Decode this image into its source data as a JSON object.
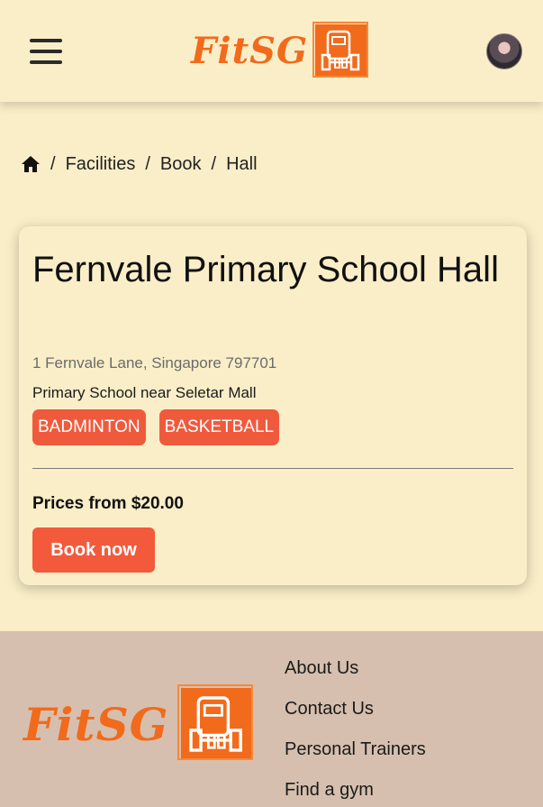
{
  "header": {
    "logo_text": "FitSG"
  },
  "breadcrumb": {
    "items": [
      "Facilities",
      "Book",
      "Hall"
    ]
  },
  "facility": {
    "title": "Fernvale Primary School Hall",
    "address": "1 Fernvale Lane, Singapore 797701",
    "description": "Primary School near Seletar Mall",
    "tags": [
      "BADMINTON",
      "BASKETBALL"
    ],
    "price_text": "Prices from $20.00",
    "book_label": "Book now"
  },
  "footer": {
    "logo_text": "FitSG",
    "links": [
      "About Us",
      "Contact Us",
      "Personal Trainers",
      "Find a gym"
    ]
  },
  "colors": {
    "background": "#faeec8",
    "accent": "#f26a1b",
    "tag": "#f05a3c",
    "footer": "#d6bfae"
  }
}
